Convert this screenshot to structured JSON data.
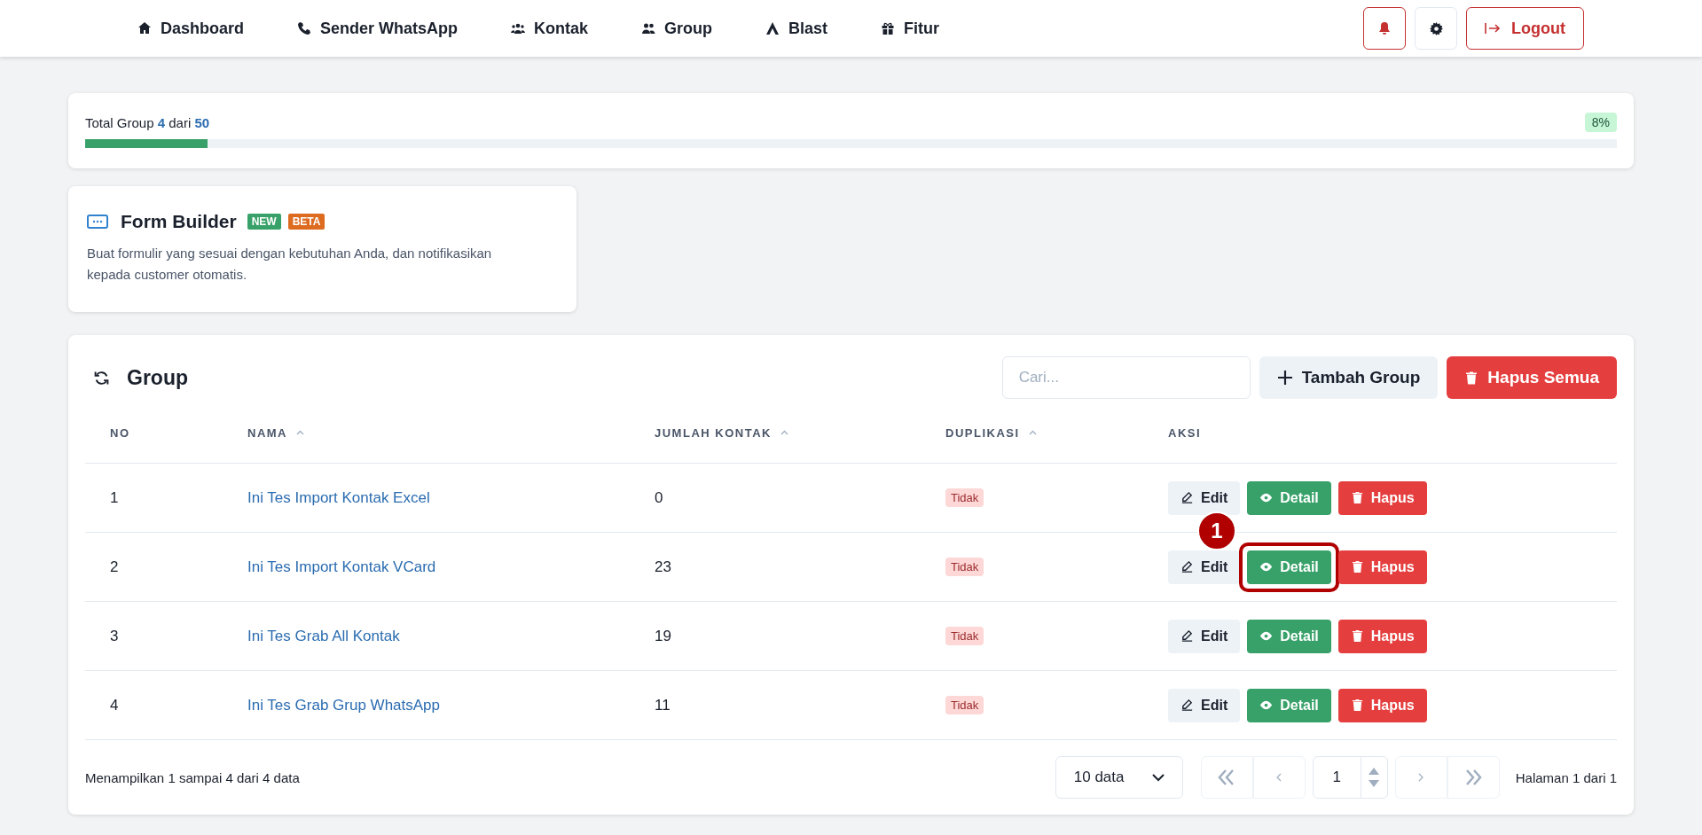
{
  "nav": {
    "items": [
      {
        "label": "Dashboard"
      },
      {
        "label": "Sender WhatsApp"
      },
      {
        "label": "Kontak"
      },
      {
        "label": "Group"
      },
      {
        "label": "Blast"
      },
      {
        "label": "Fitur"
      }
    ],
    "logout": "Logout"
  },
  "quota": {
    "prefix": "Total Group",
    "used": "4",
    "middle": "dari",
    "total": "50",
    "percent": "8%",
    "level": 0.08
  },
  "promo": {
    "title": "Form Builder",
    "badges": [
      {
        "text": "NEW",
        "color": "#38a169"
      },
      {
        "text": "BETA",
        "color": "#dd6b20"
      }
    ],
    "description": "Buat formulir yang sesuai dengan kebutuhan Anda, dan notifikasikan kepada customer otomatis."
  },
  "group": {
    "title": "Group",
    "search": {
      "placeholder": "Cari..."
    },
    "add_button": "Tambah Group",
    "delete_all_button": "Hapus Semua",
    "columns": [
      {
        "label": "NO",
        "sortable": false
      },
      {
        "label": "NAMA",
        "sortable": true
      },
      {
        "label": "JUMLAH KONTAK",
        "sortable": true
      },
      {
        "label": "DUPLIKASI",
        "sortable": true
      },
      {
        "label": "AKSI",
        "sortable": false
      }
    ],
    "rows": [
      {
        "no": "1",
        "name": "Ini Tes Import Kontak Excel",
        "count": "0",
        "duplicate": "Tidak",
        "actions": [
          "Edit",
          "Detail",
          "Hapus"
        ],
        "highlighted": false
      },
      {
        "no": "2",
        "name": "Ini Tes Import Kontak VCard",
        "count": "23",
        "duplicate": "Tidak",
        "actions": [
          "Edit",
          "Detail",
          "Hapus"
        ],
        "highlighted": true
      },
      {
        "no": "3",
        "name": "Ini Tes Grab All Kontak",
        "count": "19",
        "duplicate": "Tidak",
        "actions": [
          "Edit",
          "Detail",
          "Hapus"
        ],
        "highlighted": false
      },
      {
        "no": "4",
        "name": "Ini Tes Grab Grup WhatsApp",
        "count": "11",
        "duplicate": "Tidak",
        "actions": [
          "Edit",
          "Detail",
          "Hapus"
        ],
        "highlighted": false
      }
    ],
    "annotation": "1",
    "summary": "Menampilkan 1 sampai 4 dari 4 data",
    "page_size": "10 data",
    "page": "1",
    "page_info": "Halaman 1 dari 1"
  }
}
